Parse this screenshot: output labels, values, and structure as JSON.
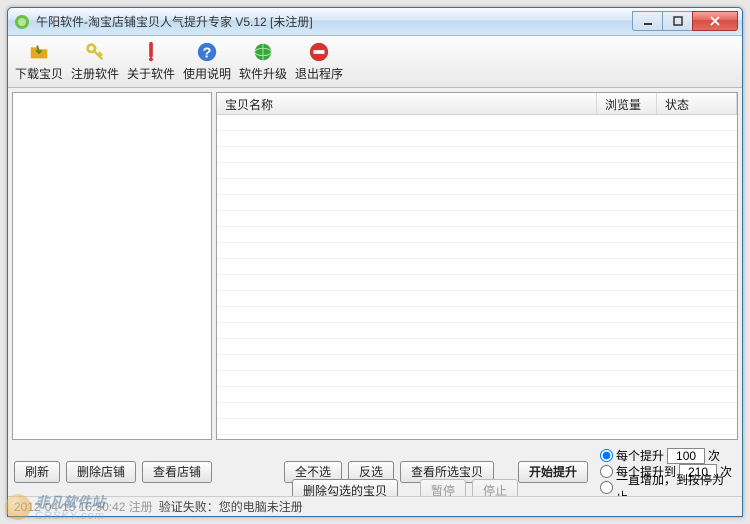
{
  "window": {
    "title": "午阳软件-淘宝店铺宝贝人气提升专家   V5.12   [未注册]"
  },
  "toolbar": {
    "items": [
      {
        "label": "下载宝贝",
        "icon": "folder-download-icon",
        "color": "#e6a817"
      },
      {
        "label": "注册软件",
        "icon": "key-icon",
        "color": "#d9c33a"
      },
      {
        "label": "关于软件",
        "icon": "info-icon",
        "color": "#d43434"
      },
      {
        "label": "使用说明",
        "icon": "help-icon",
        "color": "#3a7ad4"
      },
      {
        "label": "软件升级",
        "icon": "globe-update-icon",
        "color": "#3aa63a"
      },
      {
        "label": "退出程序",
        "icon": "exit-icon",
        "color": "#d43434"
      }
    ]
  },
  "listhead": {
    "name": "宝贝名称",
    "views": "浏览量",
    "status": "状态"
  },
  "buttons": {
    "refresh": "刷新",
    "delshop": "删除店铺",
    "viewshop": "查看店铺",
    "selnone": "全不选",
    "invert": "反选",
    "viewsel": "查看所选宝贝",
    "delsel": "删除勾选的宝贝",
    "start": "开始提升",
    "pause": "暂停",
    "stop": "停止"
  },
  "options": {
    "opt1_pre": "每个提升",
    "opt1_val": "100",
    "opt1_suf": "次",
    "opt2_pre": "每个提升到",
    "opt2_val": "210",
    "opt2_suf": "次",
    "opt3": "一直增加，到按停为止"
  },
  "status": {
    "ts": "2012-04-15 16:30:42 注册",
    "msg": "验证失败：您的电脑未注册"
  },
  "watermark": {
    "text1": "非凡软件站",
    "text2": "CRSKY.com"
  }
}
